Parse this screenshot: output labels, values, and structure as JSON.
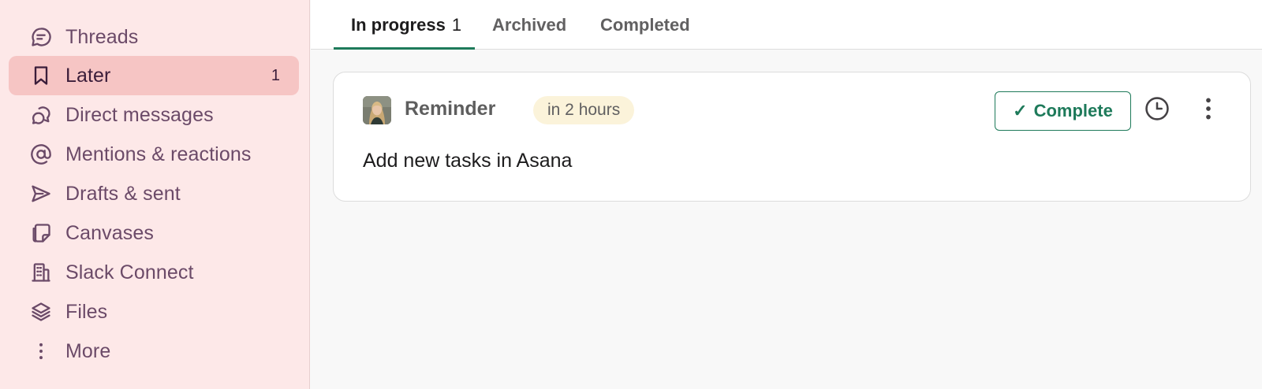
{
  "sidebar": {
    "items": [
      {
        "label": "Threads",
        "icon": "threads-icon"
      },
      {
        "label": "Later",
        "icon": "bookmark-icon",
        "badge": "1",
        "active": true
      },
      {
        "label": "Direct messages",
        "icon": "direct-messages-icon"
      },
      {
        "label": "Mentions & reactions",
        "icon": "at-sign-icon"
      },
      {
        "label": "Drafts & sent",
        "icon": "send-icon"
      },
      {
        "label": "Canvases",
        "icon": "canvas-icon"
      },
      {
        "label": "Slack Connect",
        "icon": "building-icon"
      },
      {
        "label": "Files",
        "icon": "layers-icon"
      },
      {
        "label": "More",
        "icon": "more-vertical-icon"
      }
    ]
  },
  "tabs": [
    {
      "label": "In progress",
      "count": "1",
      "active": true
    },
    {
      "label": "Archived"
    },
    {
      "label": "Completed"
    }
  ],
  "card": {
    "title": "Reminder",
    "time_badge": "in 2 hours",
    "text": "Add new tasks in Asana",
    "complete_label": "Complete"
  },
  "colors": {
    "sidebar_bg": "#fde8e8",
    "sidebar_active": "#f6c5c4",
    "accent_green": "#1e7a5a",
    "badge_bg": "#fbf3da"
  }
}
